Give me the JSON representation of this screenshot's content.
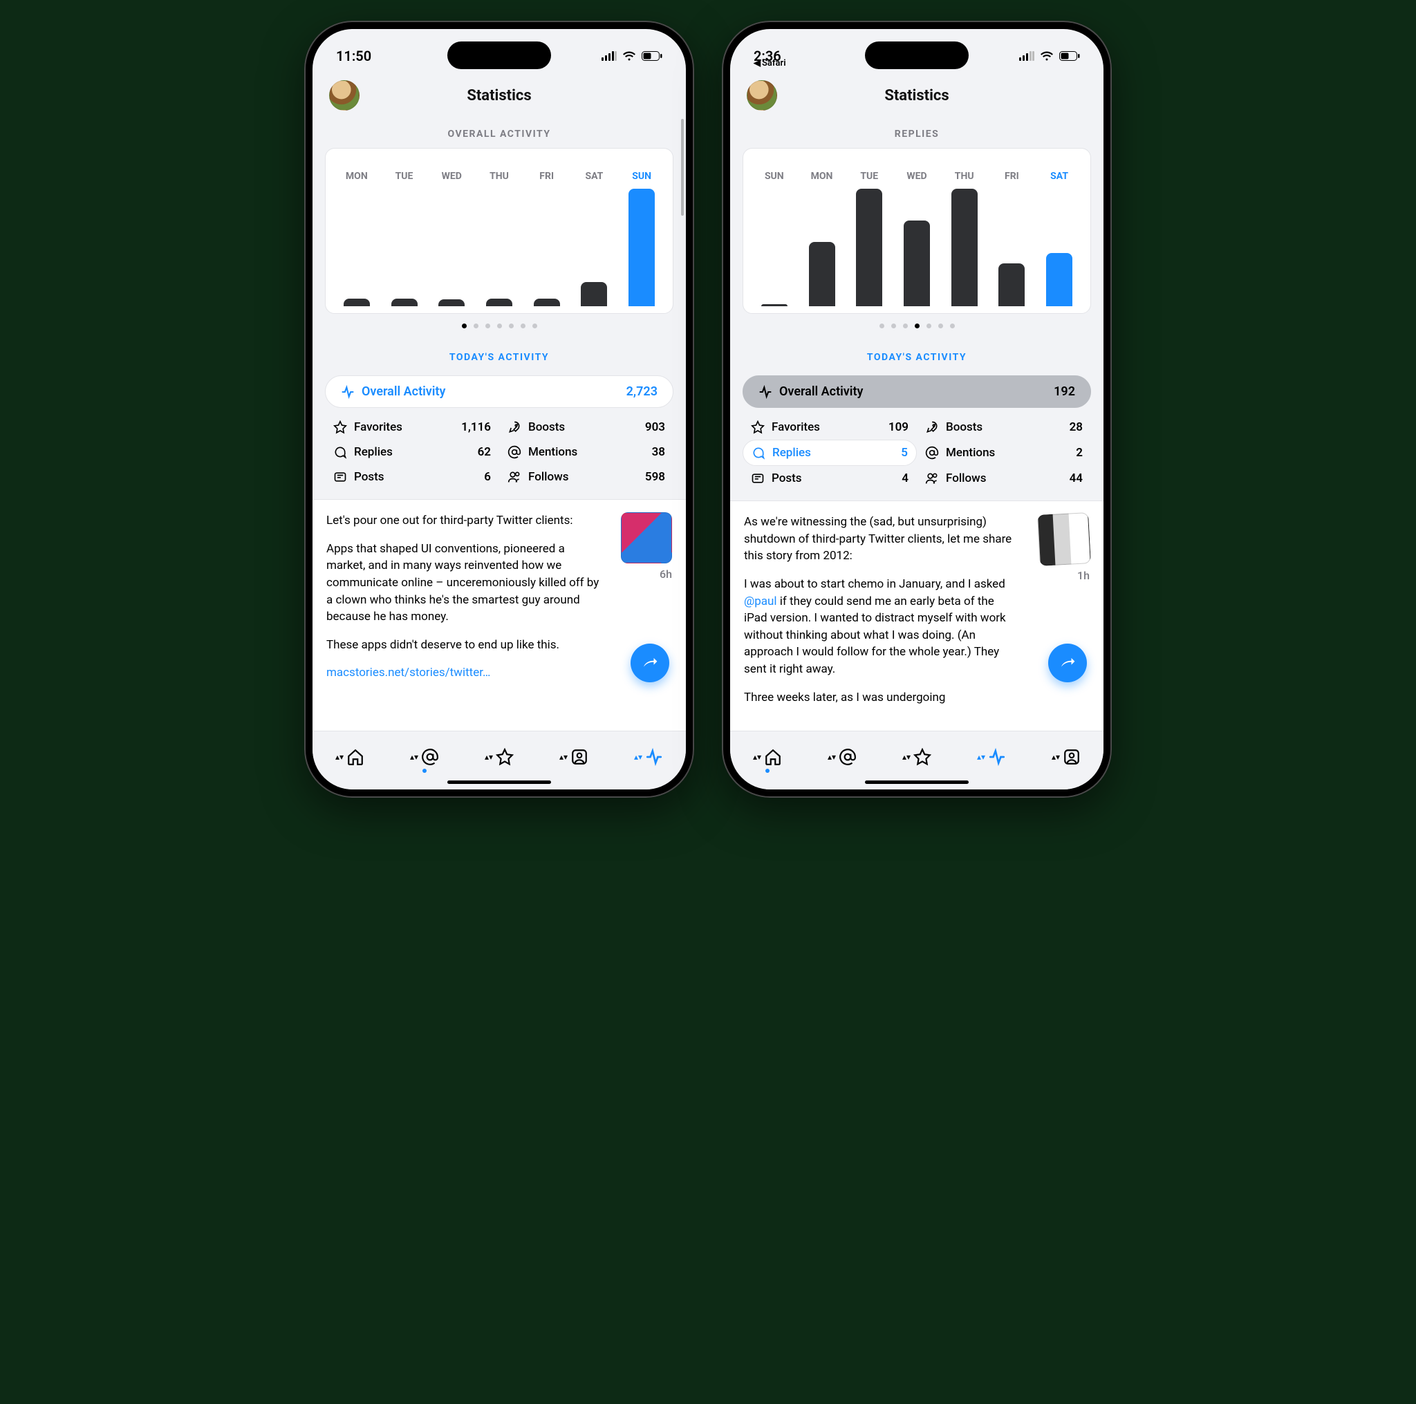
{
  "left": {
    "status": {
      "time": "11:50",
      "back": ""
    },
    "header": {
      "title": "Statistics"
    },
    "chart_title": "OVERALL ACTIVITY",
    "dots": {
      "count": 7,
      "active": 0
    },
    "today_label": "TODAY'S ACTIVITY",
    "overall": {
      "label": "Overall Activity",
      "value": "2,723"
    },
    "stats": [
      {
        "icon": "star",
        "label": "Favorites",
        "value": "1,116"
      },
      {
        "icon": "boost",
        "label": "Boosts",
        "value": "903"
      },
      {
        "icon": "reply",
        "label": "Replies",
        "value": "62"
      },
      {
        "icon": "mention",
        "label": "Mentions",
        "value": "38"
      },
      {
        "icon": "post",
        "label": "Posts",
        "value": "6"
      },
      {
        "icon": "follow",
        "label": "Follows",
        "value": "598"
      }
    ],
    "post": {
      "p1": "Let's pour one out for third-party Twitter clients:",
      "p2": "Apps that shaped UI conventions, pioneered a market, and in many ways reinvented how we communicate online – unceremoniously killed off by a clown who thinks he's the smartest guy around because he has money.",
      "p3": "These apps didn't deserve to end up like this.",
      "link": "macstories.net/stories/twitter…",
      "time": "6h"
    }
  },
  "right": {
    "status": {
      "time": "2:36",
      "back": "Safari"
    },
    "header": {
      "title": "Statistics"
    },
    "chart_title": "REPLIES",
    "dots": {
      "count": 7,
      "active": 3
    },
    "today_label": "TODAY'S ACTIVITY",
    "overall": {
      "label": "Overall Activity",
      "value": "192"
    },
    "selected_stat": 2,
    "stats": [
      {
        "icon": "star",
        "label": "Favorites",
        "value": "109"
      },
      {
        "icon": "boost",
        "label": "Boosts",
        "value": "28"
      },
      {
        "icon": "reply",
        "label": "Replies",
        "value": "5"
      },
      {
        "icon": "mention",
        "label": "Mentions",
        "value": "2"
      },
      {
        "icon": "post",
        "label": "Posts",
        "value": "4"
      },
      {
        "icon": "follow",
        "label": "Follows",
        "value": "44"
      }
    ],
    "post": {
      "p1": "As we're witnessing the (sad, but unsurprising) shutdown of third-party Twitter clients, let me share this story from 2012:",
      "p2a": "I was about to start chemo in January, and I asked ",
      "mention": "@paul",
      "p2b": " if they could send me an early beta of the iPad version. I wanted to distract myself with work without thinking about what I was doing. (An approach I would follow for the whole year.) They sent it right away.",
      "p3": "Three weeks later, as I was undergoing",
      "time": "1h"
    }
  },
  "chart_data": [
    {
      "type": "bar",
      "title": "OVERALL ACTIVITY",
      "categories": [
        "MON",
        "TUE",
        "WED",
        "THU",
        "FRI",
        "SAT",
        "SUN"
      ],
      "values": [
        180,
        180,
        160,
        170,
        180,
        560,
        2723
      ],
      "selected_index": 6,
      "xlabel": "",
      "ylabel": "",
      "ylim": [
        0,
        2723
      ]
    },
    {
      "type": "bar",
      "title": "REPLIES",
      "categories": [
        "SUN",
        "MON",
        "TUE",
        "WED",
        "THU",
        "FRI",
        "SAT"
      ],
      "values": [
        0,
        6,
        11,
        8,
        11,
        4,
        5
      ],
      "selected_index": 6,
      "xlabel": "",
      "ylabel": "",
      "ylim": [
        0,
        11
      ]
    }
  ]
}
